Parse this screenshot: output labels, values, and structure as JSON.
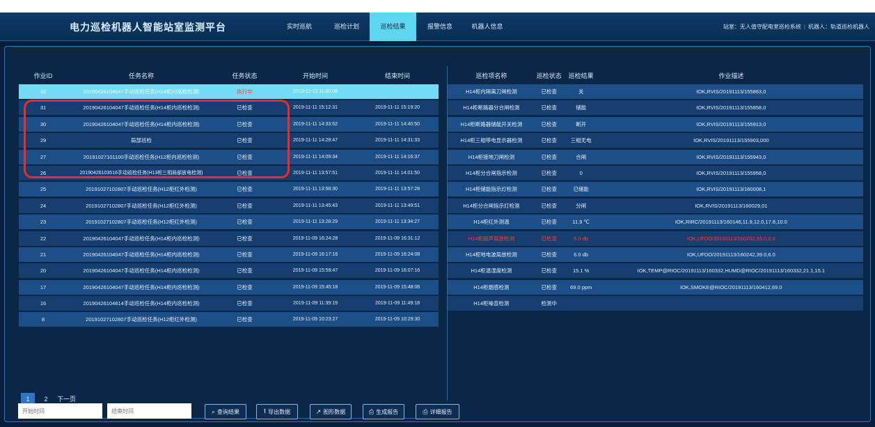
{
  "header": {
    "title": "电力巡检机器人智能站室监测平台",
    "nav": [
      "实时巡航",
      "巡检计划",
      "巡检结果",
      "报警信息",
      "机器人信息"
    ],
    "active_nav": 2,
    "station_label": "站室：",
    "station_value": "无人值守配电室巡检系统",
    "robot_label": "机器人：",
    "robot_value": "轨道巡检机器人"
  },
  "task_table": {
    "columns": [
      "作业ID",
      "任务名称",
      "任务状态",
      "开始时间",
      "结束时间"
    ],
    "rows": [
      {
        "id": "32",
        "name": "20190426104047手动巡检任务(H14柜内巡检检测)",
        "status": "执行中",
        "start": "2019-11-13 11:00:06",
        "end": "",
        "selected": true
      },
      {
        "id": "31",
        "name": "20190426104047手动巡检任务(H14柜内巡检检测)",
        "status": "已检查",
        "start": "2019-11-11 15:12:31",
        "end": "2019-11-11 15:19:20"
      },
      {
        "id": "30",
        "name": "20190426104047手动巡检任务(H14柜内巡检检测)",
        "status": "已检查",
        "start": "2019-11-11 14:33:52",
        "end": "2019-11-11 14:40:50"
      },
      {
        "id": "29",
        "name": "局部巡检",
        "status": "已检查",
        "start": "2019-11-11 14:28:47",
        "end": "2019-11-11 14:31:33"
      },
      {
        "id": "27",
        "name": "20191027101100手动巡检任务(H12柜内巡检检测)",
        "status": "已检查",
        "start": "2019-11-11 14:09:34",
        "end": "2019-11-11 14:16:37"
      },
      {
        "id": "26",
        "name": "20190426103516手动巡检任务(H13柜三相局部放电检测)",
        "status": "已检查",
        "start": "2019-11-11 13:57:51",
        "end": "2019-11-11 14:01:50",
        "two_line": true
      },
      {
        "id": "25",
        "name": "20191027102807手动巡检任务(H12柜红外检测)",
        "status": "已检查",
        "start": "2019-11-11 13:58:30",
        "end": "2019-11-11 13:57:28"
      },
      {
        "id": "24",
        "name": "20191027102807手动巡检任务(H12柜红外检测)",
        "status": "已检查",
        "start": "2019-11-11 13:45:43",
        "end": "2019-11-11 13:49:51"
      },
      {
        "id": "23",
        "name": "20191027102807手动巡检任务(H12柜红外检测)",
        "status": "已检查",
        "start": "2019-11-11 13:28:29",
        "end": "2019-11-11 13:34:27"
      },
      {
        "id": "22",
        "name": "20190426104047手动巡检任务(H14柜内巡检检测)",
        "status": "已检查",
        "start": "2019-11-09 16:24:28",
        "end": "2019-11-09 16:31:12"
      },
      {
        "id": "21",
        "name": "20190426104047手动巡检任务(H14柜内巡检检测)",
        "status": "已检查",
        "start": "2019-11-09 16:17:16",
        "end": "2019-11-09 16:24:08"
      },
      {
        "id": "20",
        "name": "20190426104047手动巡检任务(H14柜内巡检检测)",
        "status": "已检查",
        "start": "2019-11-09 15:59:47",
        "end": "2019-11-09 16:07:16"
      },
      {
        "id": "17",
        "name": "20190426104047手动巡检任务(H14柜内巡检检测)",
        "status": "已检查",
        "start": "2019-11-09 15:45:18",
        "end": "2019-11-09 15:48:06"
      },
      {
        "id": "16",
        "name": "20190426104814手动巡检任务(H14柜内巡检检测)",
        "status": "已检查",
        "start": "2019-11-09 11:39:19",
        "end": "2019-11-09 11:49:18"
      },
      {
        "id": "8",
        "name": "20191027102807手动巡检任务(H12柜红外检测)",
        "status": "已检查",
        "start": "2019-11-09 10:23:27",
        "end": "2019-11-09 10:29:30"
      }
    ]
  },
  "detail_table": {
    "columns": [
      "巡检项名称",
      "巡检状态",
      "巡检结果",
      "作业描述"
    ],
    "rows": [
      {
        "name": "H14柜内隔离刀闸检测",
        "status": "已检查",
        "result": "关",
        "desc": "IOK,RVIS/20191113/155863,0"
      },
      {
        "name": "H14柜断路器分合闸检测",
        "status": "已检查",
        "result": "储能",
        "desc": "IOK,RVIS/20191113/155858,0"
      },
      {
        "name": "H14柜断路器储能开关检测",
        "status": "已检查",
        "result": "断开",
        "desc": "IOK,RVIS/20191113/155913,0"
      },
      {
        "name": "H14柜三相带电显示器检测",
        "status": "已检查",
        "result": "三相无电",
        "desc": "IOK,RVIS/20191113/155903,000"
      },
      {
        "name": "H14柜接地刀闸检测",
        "status": "已检查",
        "result": "合闸",
        "desc": "IOK,RVIS/20191113/155943,0"
      },
      {
        "name": "H14柜分合闸指示检测",
        "status": "已检查",
        "result": "0",
        "desc": "IOK,RVIS/20191113/155958,0"
      },
      {
        "name": "H14柜储能指示灯检测",
        "status": "已检查",
        "result": "已储能",
        "desc": "IOK,RVIS/20191113/160008,1"
      },
      {
        "name": "H14柜分合闸指示灯检测",
        "status": "已检查",
        "result": "分闸",
        "desc": "IOK,RVIS/20191113/160029,01"
      },
      {
        "name": "H14柜红外测温",
        "status": "已检查",
        "result": "11.9 ℃",
        "desc": "IOK,RIRC/20191113/160146,11.9,12.0,17.8,10.0"
      },
      {
        "name": "H14柜超声局放检测",
        "status": "已检查",
        "result": "6.0 db",
        "desc": "IOK,UFDO/20191113/160202,26.0,0.0",
        "alert": true
      },
      {
        "name": "H14柜地电波局放检测",
        "status": "已检查",
        "result": "6.0 db",
        "desc": "IOK,UFDO/20191113/160242,39.0,6.0"
      },
      {
        "name": "H14柜温湿度检测",
        "status": "已检查",
        "result": "15.1 %",
        "desc": "IOK,TEMP@RIOC/20191113/160332,HUMD@RIOC/20191113/160332,21.1,15.1"
      },
      {
        "name": "H14柜烟感检测",
        "status": "已检查",
        "result": "69.0 ppm",
        "desc": "IOK,SMOKE@RIOC/20191113/160412,69.0"
      },
      {
        "name": "H14柜噪音检测",
        "status": "检测中",
        "result": "",
        "desc": ""
      }
    ]
  },
  "pagination": {
    "pages": [
      "1",
      "2"
    ],
    "active": "1",
    "next_label": "下一页"
  },
  "toolbar": {
    "start_placeholder": "开始时间",
    "end_placeholder": "结束时间",
    "buttons": [
      "查询结果",
      "导出数据",
      "图形数据",
      "生成报告",
      "详细报告"
    ]
  },
  "colors": {
    "header_bg": "#0a2e55",
    "active_tab": "#5fd6f0",
    "row_odd": "#1e4e86",
    "row_even": "#163f70",
    "selected_row": "#74dcf2",
    "alert": "#ff3b3b",
    "highlight_box": "#ee2b2b"
  }
}
